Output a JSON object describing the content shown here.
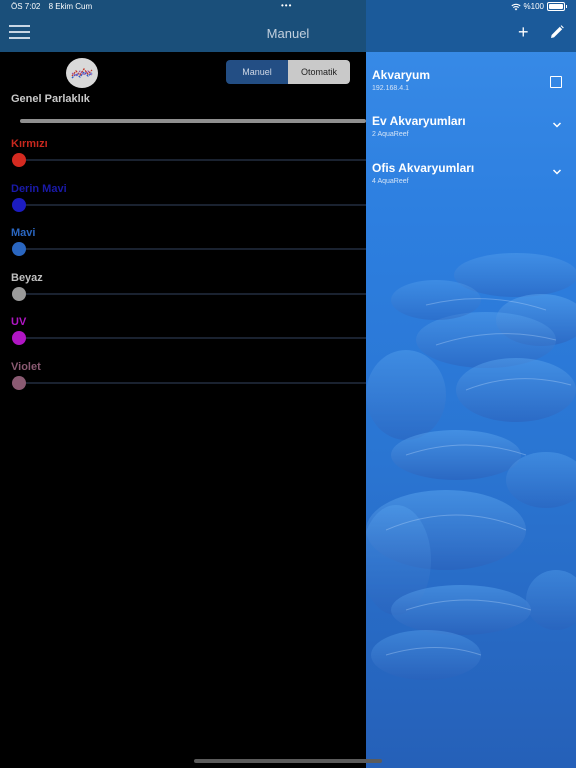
{
  "status_bar": {
    "time": "ÖS 7:02",
    "date": "8 Ekim Cum",
    "dots": "•••",
    "battery_text": "%100"
  },
  "header": {
    "title": "Manuel",
    "menu_icon": "hamburger-icon"
  },
  "chart_button": {
    "icon": "line-chart-icon"
  },
  "mode_toggle": {
    "options": [
      "Manuel",
      "Otomatik"
    ],
    "selected": "Manuel"
  },
  "overall": {
    "label": "Genel Parlaklık",
    "value": 1.0
  },
  "channels": [
    {
      "label": "Kırmızı",
      "color": "#c8281e",
      "knob": "#d42a20",
      "value": 0
    },
    {
      "label": "Derin Mavi",
      "color": "#1a1aa8",
      "knob": "#1c1cc0",
      "value": 0
    },
    {
      "label": "Mavi",
      "color": "#2a66c0",
      "knob": "#2a66c0",
      "value": 0
    },
    {
      "label": "Beyaz",
      "color": "#bfbfbf",
      "knob": "#9a9a9a",
      "value": 0
    },
    {
      "label": "UV",
      "color": "#b016c4",
      "knob": "#b016c4",
      "value": 0
    },
    {
      "label": "Violet",
      "color": "#8a5a72",
      "knob": "#8a5a72",
      "value": 0
    }
  ],
  "drawer": {
    "add_icon": "plus-icon",
    "edit_icon": "pencil-icon",
    "add_label": "+",
    "items": [
      {
        "title": "Akvaryum",
        "subtitle": "192.168.4.1",
        "control": "checkbox"
      },
      {
        "title": "Ev Akvaryumları",
        "subtitle": "2 AquaReef",
        "control": "chevron-down-icon"
      },
      {
        "title": "Ofis Akvaryumları",
        "subtitle": "4 AquaReef",
        "control": "chevron-down-icon"
      }
    ]
  },
  "colors": {
    "header_bg": "#1a4f7a",
    "drawer_bg": "#2d7fe0",
    "segment_active": "#234e84"
  }
}
